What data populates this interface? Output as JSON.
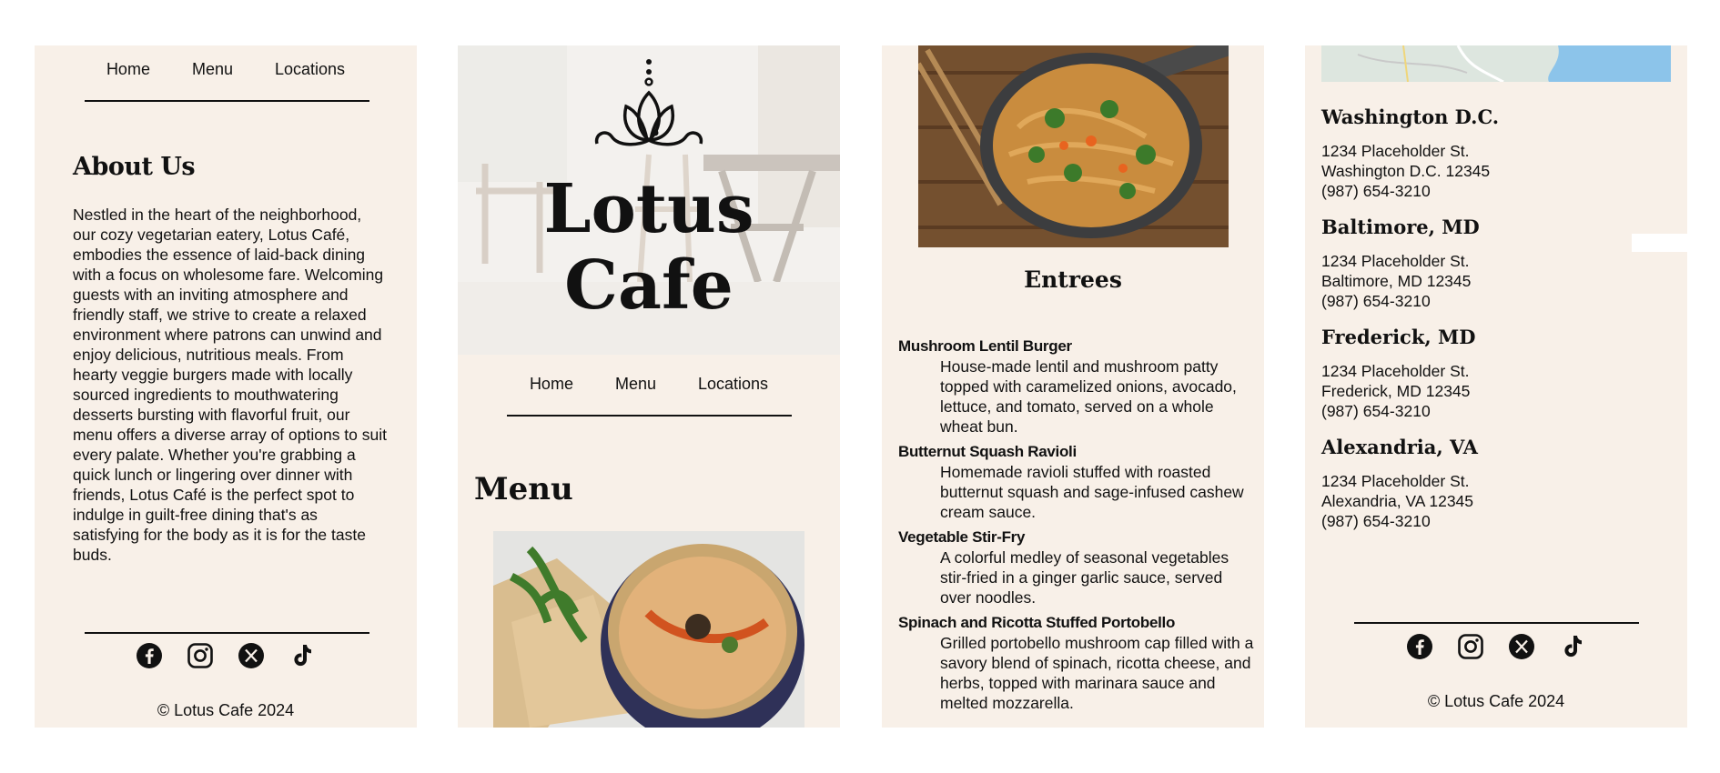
{
  "nav": {
    "home": "Home",
    "menu": "Menu",
    "locations": "Locations"
  },
  "about": {
    "heading": "About Us",
    "text": "Nestled in the heart of the neighborhood, our cozy vegetarian eatery, Lotus Café, embodies the essence of laid-back dining with a focus on wholesome fare. Welcoming guests with an inviting atmosphere and friendly staff, we strive to create a relaxed environment where patrons can unwind and enjoy delicious, nutritious meals. From hearty veggie burgers made with locally sourced ingredients to mouthwatering desserts bursting with flavorful fruit, our menu offers a diverse array of options to suit every palate. Whether you're grabbing a quick lunch or lingering over dinner with friends, Lotus Café is the perfect spot to indulge in guilt-free dining that's as satisfying for the body as it is for the taste buds."
  },
  "brand": {
    "line1": "Lotus",
    "line2": "Cafe"
  },
  "menu_heading": "Menu",
  "entrees": {
    "heading": "Entrees",
    "items": [
      {
        "name": "Mushroom Lentil Burger",
        "desc": "House-made lentil and mushroom patty topped with caramelized onions, avocado, lettuce, and tomato, served on a whole wheat bun."
      },
      {
        "name": "Butternut Squash Ravioli",
        "desc": "Homemade ravioli stuffed with roasted butternut squash and sage-infused cashew cream sauce."
      },
      {
        "name": "Vegetable Stir-Fry",
        "desc": "A colorful medley of seasonal vegetables stir-fried in a ginger garlic sauce, served over noodles."
      },
      {
        "name": "Spinach and Ricotta Stuffed Portobello",
        "desc": "Grilled portobello mushroom cap filled with a savory blend of spinach, ricotta cheese, and herbs, topped with marinara sauce and melted mozzarella."
      }
    ]
  },
  "locations": [
    {
      "city": "Washington D.C.",
      "street": "1234 Placeholder St.",
      "citystate": "Washington D.C. 12345",
      "phone": "(987) 654-3210"
    },
    {
      "city": "Baltimore, MD",
      "street": "1234 Placeholder St.",
      "citystate": "Baltimore, MD 12345",
      "phone": "(987) 654-3210"
    },
    {
      "city": "Frederick, MD",
      "street": "1234 Placeholder St.",
      "citystate": "Frederick, MD 12345",
      "phone": "(987) 654-3210"
    },
    {
      "city": "Alexandria, VA",
      "street": "1234 Placeholder St.",
      "citystate": "Alexandria, VA 12345",
      "phone": "(987) 654-3210"
    }
  ],
  "footer": {
    "copyright": "© Lotus Cafe 2024"
  },
  "social_icons": [
    "facebook-icon",
    "instagram-icon",
    "x-icon",
    "tiktok-icon"
  ],
  "colors": {
    "panel_bg": "#f8f0e8",
    "text": "#111111",
    "page_bg": "#ffffff"
  }
}
